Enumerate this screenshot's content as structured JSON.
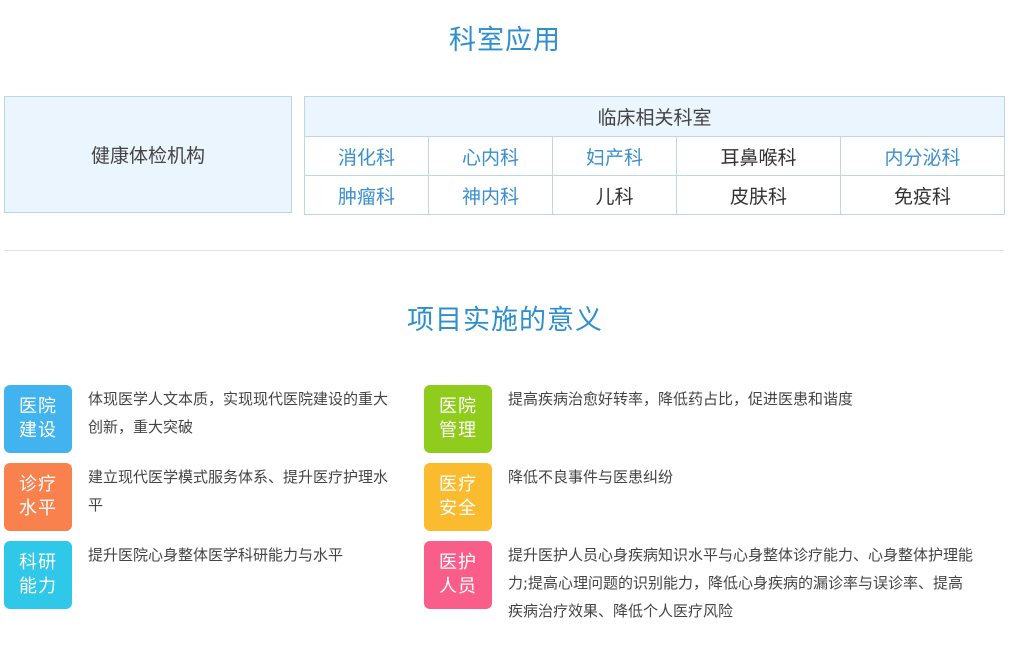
{
  "section1": {
    "title": "科室应用",
    "org_label": "健康体检机构",
    "table_header": "临床相关科室",
    "rows": [
      [
        "消化科",
        "心内科",
        "妇产科",
        "耳鼻喉科",
        "内分泌科"
      ],
      [
        "肿瘤科",
        "神内科",
        "儿科",
        "皮肤科",
        "免疫科"
      ]
    ]
  },
  "section2": {
    "title": "项目实施的意义",
    "items": [
      {
        "line1": "医院",
        "line2": "建设",
        "color": "#41b4f0",
        "text": "体现医学人文本质，实现现代医院建设的重大创新，重大突破"
      },
      {
        "line1": "医院",
        "line2": "管理",
        "color": "#8fcc1c",
        "text": "提高疾病治愈好转率，降低药占比，促进医患和谐度"
      },
      {
        "line1": "诊疗",
        "line2": "水平",
        "color": "#f8814d",
        "text": "建立现代医学模式服务体系、提升医疗护理水平"
      },
      {
        "line1": "医疗",
        "line2": "安全",
        "color": "#fbbb2e",
        "text": "降低不良事件与医患纠纷"
      },
      {
        "line1": "科研",
        "line2": "能力",
        "color": "#2fc8e8",
        "text": "提升医院心身整体医学科研能力与水平"
      },
      {
        "line1": "医护",
        "line2": "人员",
        "color": "#fb5d8b",
        "text": "提升医护人员心身疾病知识水平与心身整体诊疗能力、心身整体护理能力;提高心理问题的识别能力，降低心身疾病的漏诊率与误诊率、提高疾病治疗效果、降低个人医疗风险"
      }
    ]
  }
}
